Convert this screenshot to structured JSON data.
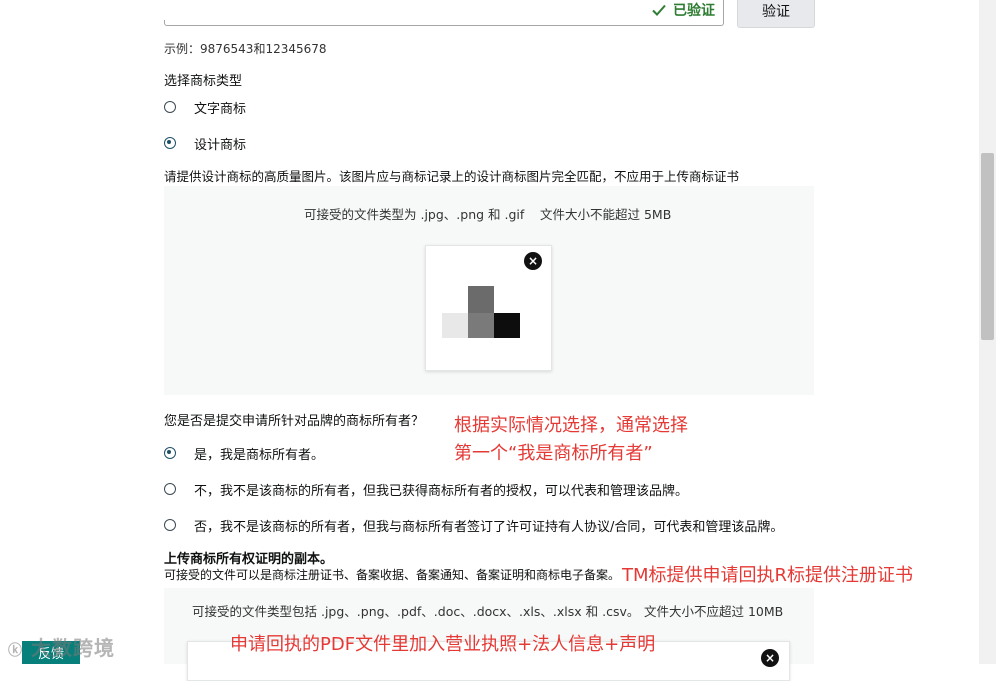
{
  "registration": {
    "verified_label": "已验证",
    "verify_button": "验证",
    "example_hint": "示例：9876543和12345678"
  },
  "trademark_type": {
    "heading": "选择商标类型",
    "options": [
      {
        "label": "文字商标",
        "selected": false
      },
      {
        "label": "设计商标",
        "selected": true
      }
    ]
  },
  "design_image": {
    "instruction": "请提供设计商标的高质量图片。该图片应与商标记录上的设计商标图片完全匹配，不应用于上传商标证书",
    "accepted_types": "可接受的文件类型为 .jpg、.png 和 .gif",
    "max_size": "文件大小不能超过 5MB",
    "remove_icon": "×"
  },
  "owner": {
    "question": "您是否是提交申请所针对品牌的商标所有者？",
    "options": [
      {
        "label": "是，我是商标所有者。",
        "selected": true
      },
      {
        "label": "不，我不是该商标的所有者，但我已获得商标所有者的授权，可以代表和管理该品牌。",
        "selected": false
      },
      {
        "label": "否，我不是该商标的所有者，但我与商标所有者签订了许可证持有人协议/合同，可代表和管理该品牌。",
        "selected": false
      }
    ]
  },
  "ownership_proof": {
    "heading": "上传商标所有权证明的副本。",
    "description": "可接受的文件可以是商标注册证书、备案收据、备案通知、备案证明和商标电子备案。",
    "accepted_types": "可接受的文件类型包括 .jpg、.png、.pdf、.doc、.docx、.xls、.xlsx 和 .csv。",
    "max_size": "文件大小不应超过 10MB",
    "remove_icon": "×"
  },
  "annotations": {
    "owner_note_line1": "根据实际情况选择，通常选择",
    "owner_note_line2": "第一个“我是商标所有者”",
    "proof_note": "TM标提供申请回执R标提供注册证书",
    "pdf_note": "申请回执的PDF文件里加入营业执照+法人信息+声明"
  },
  "feedback_button": "反馈",
  "watermark": "大数跨境",
  "colors": {
    "annotation": "#e53935",
    "verified": "#2e7d32",
    "feedback_bg": "#077f7a"
  }
}
